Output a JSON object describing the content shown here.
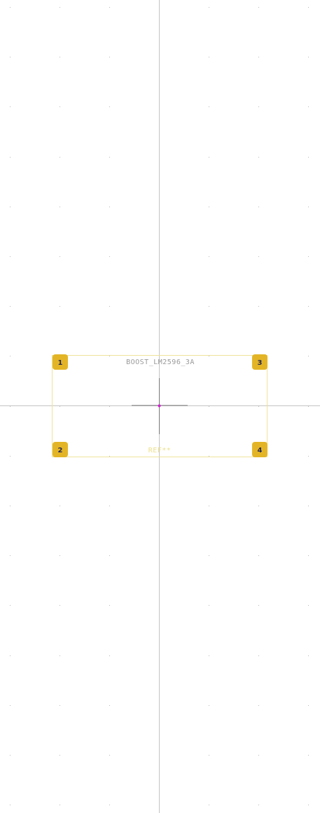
{
  "footprint": {
    "value_text": "BOOST_LM2596_3A",
    "reference_text": "REF**",
    "pads": [
      {
        "number": "1"
      },
      {
        "number": "2"
      },
      {
        "number": "3"
      },
      {
        "number": "4"
      }
    ]
  },
  "colors": {
    "background": "#ffffff",
    "grid_dot": "#b8b8b8",
    "axis": "#c4c4c4",
    "origin_cross": "#777777",
    "origin_marker": "#d020d0",
    "courtyard": "#efe39a",
    "pad_fill": "#e3b526",
    "pad_text": "#2a2a50",
    "value_text": "#9a9a9a",
    "reference_text": "#ece08a"
  }
}
